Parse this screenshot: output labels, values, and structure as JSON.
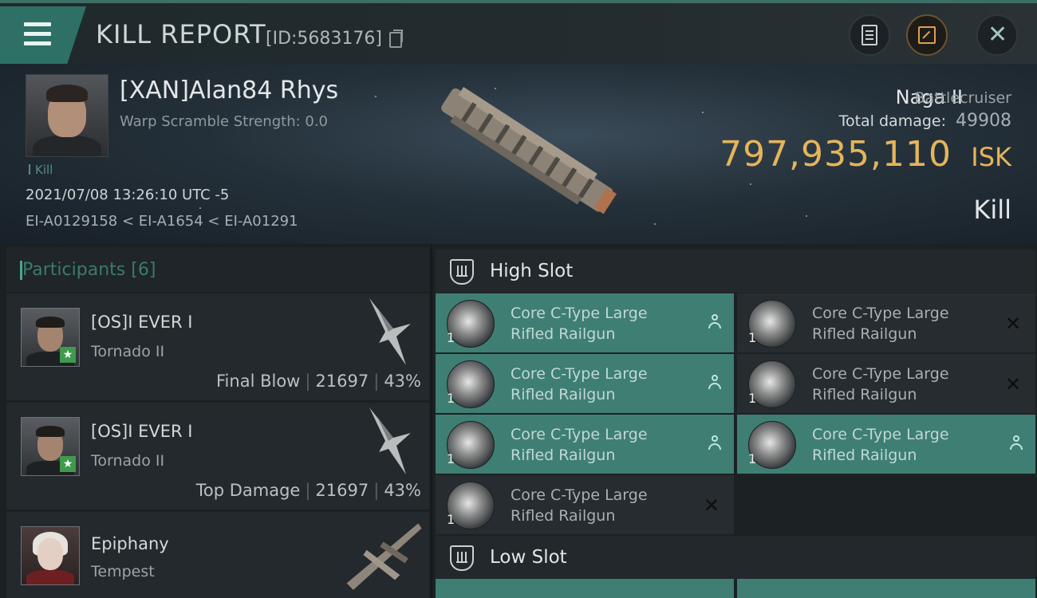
{
  "header": {
    "title": "KILL REPORT",
    "report_id": "[ID:5683176]"
  },
  "victim": {
    "name": "[XAN]Alan84 Rhys",
    "warp_scramble": "Warp Scramble Strength: 0.0",
    "kill_tag": "Kill",
    "datetime": "2021/07/08 13:26:10 UTC -5",
    "route": "EI-A0129158 < EI-A1654 < EI-A01291",
    "ship_name": "Naga II",
    "ship_class": "Battlecruiser",
    "total_damage_label": "Total damage:",
    "total_damage": "49908",
    "isk_value": "797,935,110",
    "isk_unit": "ISK",
    "result": "Kill"
  },
  "participants": {
    "label": "Participants",
    "count": "[6]",
    "items": [
      {
        "name": "[OS]I EVER I",
        "ship": "Tornado II",
        "role": "Final Blow",
        "damage": "21697",
        "percent": "43%"
      },
      {
        "name": "[OS]I EVER I",
        "ship": "Tornado II",
        "role": "Top Damage",
        "damage": "21697",
        "percent": "43%"
      },
      {
        "name": "Epiphany",
        "ship": "Tempest"
      }
    ]
  },
  "slots": {
    "high": {
      "label": "High Slot",
      "modules": [
        {
          "line1": "Core C-Type Large",
          "line2": "Rifled Railgun",
          "qty": "1",
          "state": "on"
        },
        {
          "line1": "Core C-Type Large",
          "line2": "Rifled Railgun",
          "qty": "1",
          "state": "off"
        },
        {
          "line1": "Core C-Type Large",
          "line2": "Rifled Railgun",
          "qty": "1",
          "state": "on"
        },
        {
          "line1": "Core C-Type Large",
          "line2": "Rifled Railgun",
          "qty": "1",
          "state": "off"
        },
        {
          "line1": "Core C-Type Large",
          "line2": "Rifled Railgun",
          "qty": "1",
          "state": "on"
        },
        {
          "line1": "Core C-Type Large",
          "line2": "Rifled Railgun",
          "qty": "1",
          "state": "on"
        },
        {
          "line1": "Core C-Type Large",
          "line2": "Rifled Railgun",
          "qty": "1",
          "state": "off"
        }
      ]
    },
    "low": {
      "label": "Low Slot"
    }
  },
  "colors": {
    "accent": "#2e7066",
    "isk": "#e5b45b",
    "module_on": "#3f7e73"
  }
}
